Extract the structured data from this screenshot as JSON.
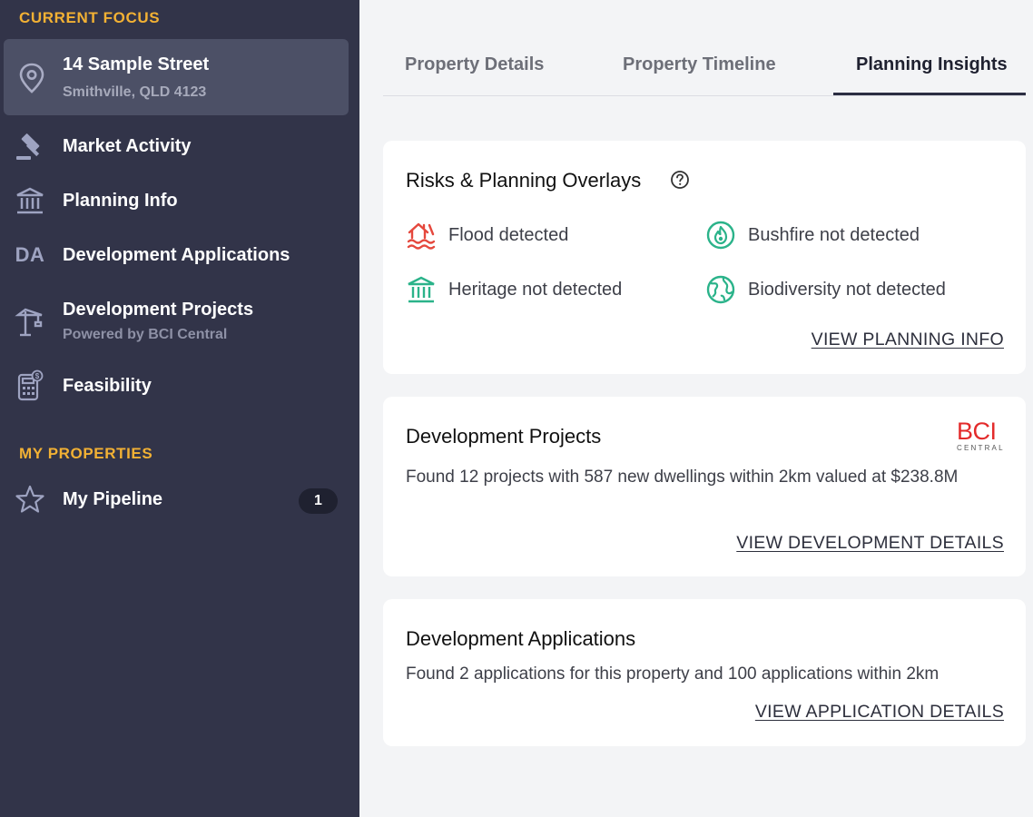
{
  "sidebar": {
    "current_focus_label": "CURRENT FOCUS",
    "focus": {
      "title": "14 Sample Street",
      "subtitle": "Smithville, QLD 4123",
      "icon": "map-pin-icon"
    },
    "nav": [
      {
        "label": "Market Activity",
        "icon": "gavel-icon"
      },
      {
        "label": "Planning Info",
        "icon": "bank-icon"
      },
      {
        "label": "Development Applications",
        "icon_text": "DA"
      },
      {
        "label": "Development Projects",
        "sublabel": "Powered by BCI Central",
        "icon": "crane-icon"
      },
      {
        "label": "Feasibility",
        "icon": "calculator-icon"
      }
    ],
    "my_properties_label": "MY PROPERTIES",
    "pipeline": {
      "label": "My Pipeline",
      "count": "1",
      "icon": "star-icon"
    }
  },
  "tabs": [
    {
      "label": "Property Details",
      "active": false
    },
    {
      "label": "Property Timeline",
      "active": false
    },
    {
      "label": "Planning Insights",
      "active": true
    }
  ],
  "risks_card": {
    "title": "Risks & Planning Overlays",
    "items": [
      {
        "label": "Flood detected",
        "icon": "flood-icon",
        "color": "#e5483d"
      },
      {
        "label": "Bushfire not detected",
        "icon": "fire-icon",
        "color": "#2bb38a"
      },
      {
        "label": "Heritage not detected",
        "icon": "heritage-icon",
        "color": "#2bb38a"
      },
      {
        "label": "Biodiversity not detected",
        "icon": "globe-icon",
        "color": "#2bb38a"
      }
    ],
    "link": "VIEW PLANNING INFO"
  },
  "projects_card": {
    "title": "Development Projects",
    "text": "Found 12 projects with 587 new dwellings within 2km valued at $238.8M",
    "logo_main": "BCI",
    "logo_sub": "CENTRAL",
    "link": "VIEW DEVELOPMENT DETAILS"
  },
  "applications_card": {
    "title": "Development Applications",
    "text": "Found 2 applications for this property and 100 applications within 2km",
    "link": "VIEW APPLICATION DETAILS"
  }
}
